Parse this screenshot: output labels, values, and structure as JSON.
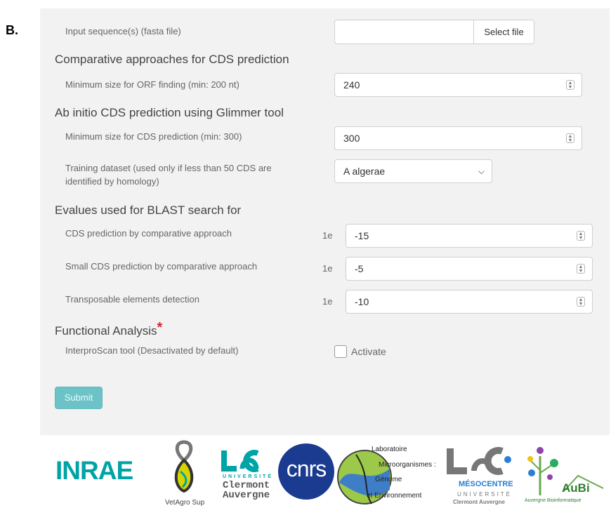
{
  "panel_label": "B.",
  "input_sequence": {
    "label": "Input sequence(s) (fasta file)",
    "button": "Select file"
  },
  "comparative": {
    "title": "Comparative approaches for CDS prediction",
    "orf_label": "Minimum size for ORF finding (min: 200 nt)",
    "orf_value": "240"
  },
  "abinitio": {
    "title": "Ab initio CDS prediction using Glimmer tool",
    "cds_label": "Minimum size for CDS prediction (min: 300)",
    "cds_value": "300",
    "training_label_1": "Training dataset (used only if less than 50 CDS are",
    "training_label_2": "identified by homology)",
    "training_value": "A algerae"
  },
  "evalues": {
    "title": "Evalues used for BLAST search for",
    "prefix": "1e",
    "rows": [
      {
        "label": "CDS prediction by comparative approach",
        "value": "-15"
      },
      {
        "label": "Small CDS prediction by comparative approach",
        "value": "-5"
      },
      {
        "label": "Transposable elements detection",
        "value": "-10"
      }
    ]
  },
  "functional": {
    "title": "Functional Analysis",
    "required_mark": "*",
    "interpro_label": "InterproScan tool (Desactivated by default)",
    "activate_label": "Activate"
  },
  "submit_label": "Submit",
  "logos": {
    "inrae": "INRAE",
    "vetagro": "VetAgro Sup",
    "uca_1": "UNIVERSITÉ",
    "uca_2": "Clermont",
    "uca_3": "Auvergne",
    "cnrs": "cnrs",
    "lmge_1": "Laboratoire",
    "lmge_2": "Microorganismes :",
    "lmge_3": "Génome",
    "lmge_4": "et Environnement",
    "meso_1": "MÉSOCENTRE",
    "meso_2": "UNIVERSITÉ",
    "meso_3": "Clermont Auvergne",
    "aubi_1": "AuBi",
    "aubi_2": "Auvergne Bioinformatique"
  },
  "colors": {
    "submit": "#6cc3c7",
    "required": "#d9232d",
    "inrae": "#00a3a6",
    "cnrs": "#1a3b8f",
    "uca": "#5a5a5a",
    "aubi": "#2f7d32"
  }
}
